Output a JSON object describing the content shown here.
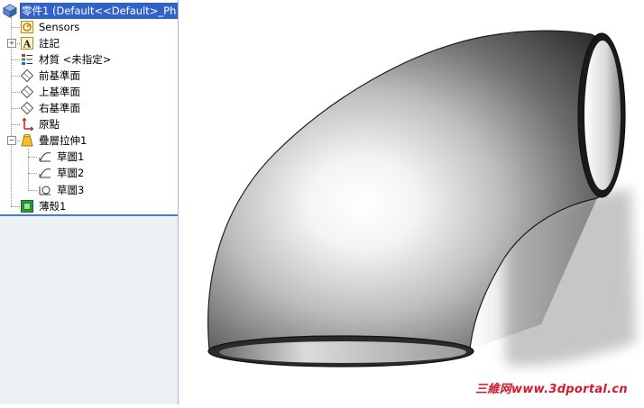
{
  "tree": {
    "root_label": "零件1  (Default<<Default>_Ph",
    "items": [
      {
        "label": "Sensors",
        "icon": "sensors-icon"
      },
      {
        "label": "註記",
        "icon": "annotation-icon"
      },
      {
        "label": "材質 <未指定>",
        "icon": "material-icon"
      },
      {
        "label": "前基準面",
        "icon": "plane-icon"
      },
      {
        "label": "上基準面",
        "icon": "plane-icon"
      },
      {
        "label": "右基準面",
        "icon": "plane-icon"
      },
      {
        "label": "原點",
        "icon": "origin-icon"
      },
      {
        "label": "疊層拉伸1",
        "icon": "loft-icon"
      },
      {
        "label": "草圖1",
        "icon": "sketch-icon"
      },
      {
        "label": "草圖2",
        "icon": "sketch-icon"
      },
      {
        "label": "草圖3",
        "icon": "sketch-icon"
      },
      {
        "label": "薄殼1",
        "icon": "shell-icon"
      }
    ]
  },
  "watermark": "三維网www.3dportal.cn"
}
